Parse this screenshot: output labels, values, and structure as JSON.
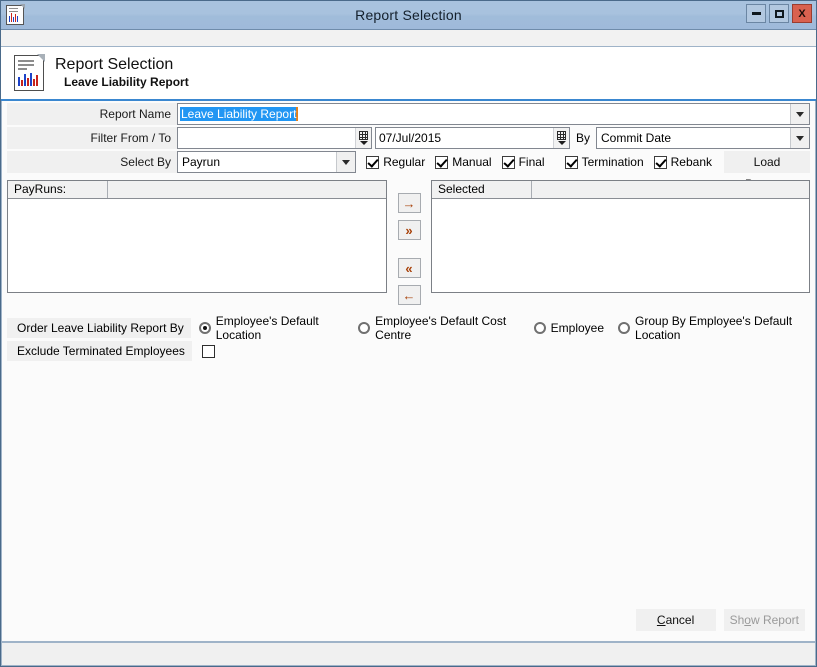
{
  "window": {
    "title": "Report Selection",
    "icon": "report-document-icon",
    "minimize_label": "",
    "maximize_label": "",
    "close_label": "X"
  },
  "banner": {
    "icon": "report-document-icon",
    "heading": "Report Selection",
    "subheading": "Leave Liability Report"
  },
  "form": {
    "report_name": {
      "label": "Report Name",
      "value": "Leave Liability Report"
    },
    "filter": {
      "label": "Filter From / To",
      "from_value": "",
      "to_value": "07/Jul/2015",
      "by_label": "By",
      "by_value": "Commit Date"
    },
    "select_by": {
      "label": "Select By",
      "value": "Payrun"
    },
    "checkboxes": [
      {
        "label": "Regular",
        "checked": true
      },
      {
        "label": "Manual",
        "checked": true
      },
      {
        "label": "Final",
        "checked": true
      },
      {
        "label": "Termination",
        "checked": true
      },
      {
        "label": "Rebank",
        "checked": true
      }
    ],
    "load_payruns_label": "Load Payruns"
  },
  "lists": {
    "available_header": "PayRuns:",
    "selected_header": "Selected PayRuns",
    "available_items": [],
    "selected_items": [],
    "buttons": [
      {
        "name": "move-right",
        "glyph": "→"
      },
      {
        "name": "move-all-right",
        "glyph": "»"
      },
      {
        "name": "move-all-left",
        "glyph": "«"
      },
      {
        "name": "move-left",
        "glyph": "←"
      }
    ]
  },
  "options": {
    "order_label": "Order Leave Liability Report By",
    "order_choices": [
      {
        "label": "Employee's Default Location",
        "selected": true
      },
      {
        "label": "Employee's Default Cost Centre",
        "selected": false
      },
      {
        "label": "Employee",
        "selected": false
      },
      {
        "label": "Group By Employee's Default Location",
        "selected": false
      }
    ],
    "exclude_label": "Exclude Terminated Employees",
    "exclude_checked": false
  },
  "footer": {
    "cancel_label": "Cancel",
    "cancel_accel": "C",
    "show_report_label": "Show Report",
    "show_report_accel": "o",
    "show_report_disabled": true
  },
  "statusbar": {
    "text": ""
  },
  "colors": {
    "titlebar": "#a8c2de",
    "accent_underline": "#3a87d0",
    "selection_blue": "#2196f3",
    "arrow_orange": "#a8420a",
    "close_red": "#d9614f"
  }
}
